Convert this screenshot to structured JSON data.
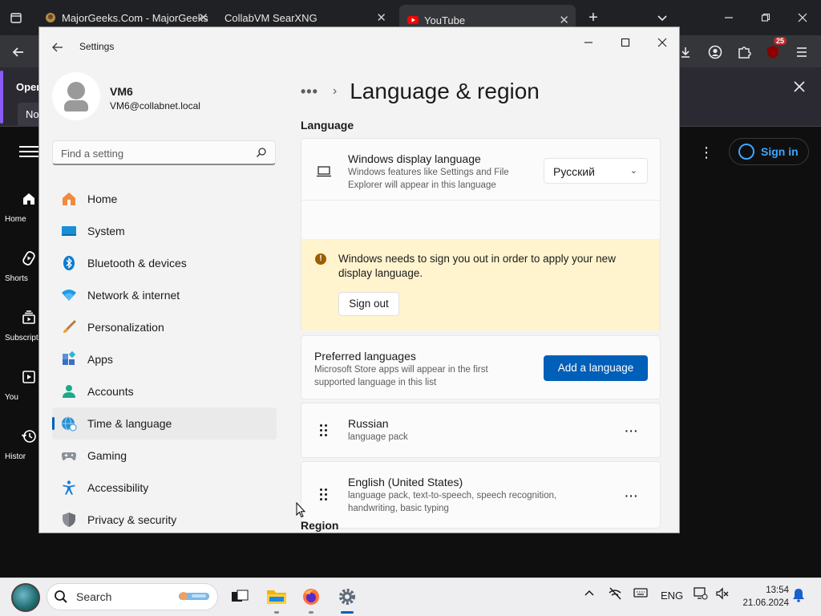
{
  "browser": {
    "tabs": [
      {
        "title": "MajorGeeks.Com - MajorGeeks",
        "close": "✕"
      },
      {
        "title": "CollabVM SearXNG",
        "close": "✕"
      },
      {
        "title": "YouTube",
        "close": "✕"
      }
    ],
    "new_tab": "+",
    "extensions_badge": "25",
    "infobar": {
      "title_partial": "Oper",
      "button_partial": "No"
    },
    "youtube": {
      "nav": [
        {
          "label": "Home",
          "icon": "home-icon"
        },
        {
          "label": "Shorts",
          "icon": "shorts-icon"
        },
        {
          "label": "Subscripti",
          "icon": "subscriptions-icon"
        },
        {
          "label": "You",
          "icon": "you-icon"
        },
        {
          "label": "Histor",
          "icon": "history-icon"
        }
      ],
      "sign_in": "Sign in"
    }
  },
  "settings": {
    "app_title": "Settings",
    "user": {
      "name": "VM6",
      "email": "VM6@collabnet.local"
    },
    "search": {
      "placeholder": "Find a setting"
    },
    "nav": [
      {
        "label": "Home"
      },
      {
        "label": "System"
      },
      {
        "label": "Bluetooth & devices"
      },
      {
        "label": "Network & internet"
      },
      {
        "label": "Personalization"
      },
      {
        "label": "Apps"
      },
      {
        "label": "Accounts"
      },
      {
        "label": "Time & language",
        "selected": true
      },
      {
        "label": "Gaming"
      },
      {
        "label": "Accessibility"
      },
      {
        "label": "Privacy & security"
      }
    ],
    "breadcrumb": {
      "dots": "•••",
      "separator": "›",
      "title": "Language & region"
    },
    "language_section": "Language",
    "display_language": {
      "title": "Windows display language",
      "description": "Windows features like Settings and File Explorer will appear in this language",
      "selected": "Русский"
    },
    "warning": {
      "text": "Windows needs to sign you out in order to apply your new display language.",
      "button": "Sign out"
    },
    "preferred": {
      "title": "Preferred languages",
      "description": "Microsoft Store apps will appear in the first supported language in this list",
      "button": "Add a language"
    },
    "languages": [
      {
        "name": "Russian",
        "features": "language pack",
        "more": "···"
      },
      {
        "name": "English (United States)",
        "features": "language pack, text-to-speech, speech recognition, handwriting, basic typing",
        "more": "···"
      }
    ],
    "region_section": "Region"
  },
  "taskbar": {
    "search": "Search",
    "language": "ENG",
    "time": "13:54",
    "date": "21.06.2024"
  },
  "colors": {
    "accent": "#005fb8",
    "warning_bg": "#fff4ce",
    "youtube_red": "#ff0000",
    "signin_blue": "#3ea6ff"
  }
}
